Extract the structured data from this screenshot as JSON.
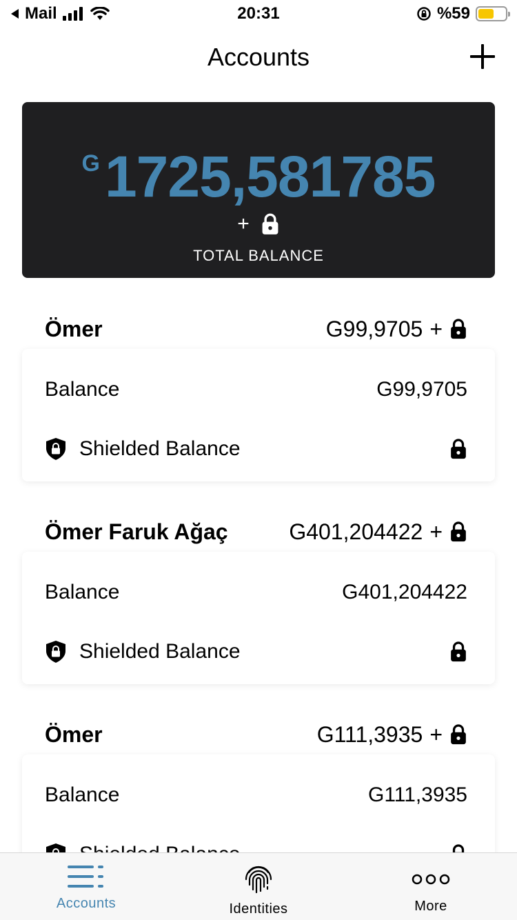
{
  "status_bar": {
    "back_app": "Mail",
    "time": "20:31",
    "battery_percent": "%59",
    "battery_level": 0.59
  },
  "header": {
    "title": "Accounts",
    "add_icon": "plus-icon"
  },
  "total": {
    "currency_symbol": "G",
    "amount": "1725,581785",
    "plus": "+",
    "lock_icon": "lock-icon",
    "label": "TOTAL BALANCE"
  },
  "accounts": [
    {
      "name": "Ömer",
      "header_total": "G99,9705",
      "plus": "+",
      "balance_label": "Balance",
      "balance_value": "G99,9705",
      "shielded_label": "Shielded Balance"
    },
    {
      "name": "Ömer Faruk Ağaç",
      "header_total": "G401,204422",
      "plus": "+",
      "balance_label": "Balance",
      "balance_value": "G401,204422",
      "shielded_label": "Shielded Balance"
    },
    {
      "name": "Ömer",
      "header_total": "G111,3935",
      "plus": "+",
      "balance_label": "Balance",
      "balance_value": "G111,3935",
      "shielded_label": "Shielded Balance"
    }
  ],
  "tabs": [
    {
      "label": "Accounts",
      "icon": "list-icon",
      "active": true
    },
    {
      "label": "Identities",
      "icon": "fingerprint-icon",
      "active": false
    },
    {
      "label": "More",
      "icon": "more-icon",
      "active": false
    }
  ],
  "colors": {
    "accent": "#4585b0",
    "card_dark": "#1f1f21",
    "battery": "#f7c600"
  }
}
